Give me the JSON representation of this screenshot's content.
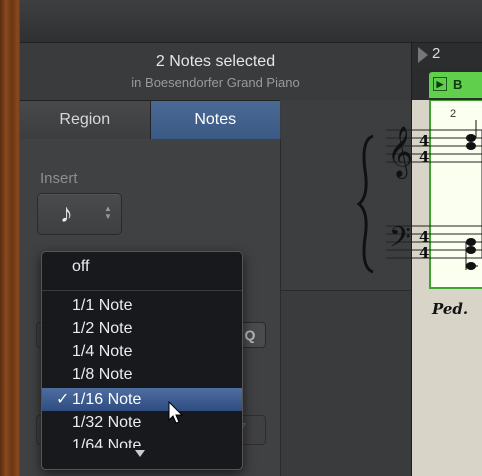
{
  "inspector": {
    "title": "2 Notes selected",
    "subtitle": "in Boesendorfer Grand Piano"
  },
  "tabs": [
    {
      "label": "Region",
      "active": false
    },
    {
      "label": "Notes",
      "active": true
    }
  ],
  "insert": {
    "label": "Insert",
    "value_icon": "eighth-note-icon",
    "glyph": "♪"
  },
  "ruler": {
    "bar": "2"
  },
  "region": {
    "name": "B",
    "small_number": "2"
  },
  "score": {
    "pedal": "Ped."
  },
  "quantize_button": "Q",
  "dropdown": {
    "items": [
      {
        "label": "off",
        "selected": false
      },
      {
        "label": "1/1 Note",
        "selected": false
      },
      {
        "label": "1/2 Note",
        "selected": false
      },
      {
        "label": "1/4 Note",
        "selected": false
      },
      {
        "label": "1/8 Note",
        "selected": false
      },
      {
        "label": "1/16 Note",
        "selected": true
      },
      {
        "label": "1/32 Note",
        "selected": false
      },
      {
        "label": "1/64 Note",
        "selected": false
      }
    ],
    "check_glyph": "✓"
  },
  "colors": {
    "accent": "#3a5a85",
    "region_green": "#5fcf4c",
    "selected_item": "#2e4c80"
  }
}
